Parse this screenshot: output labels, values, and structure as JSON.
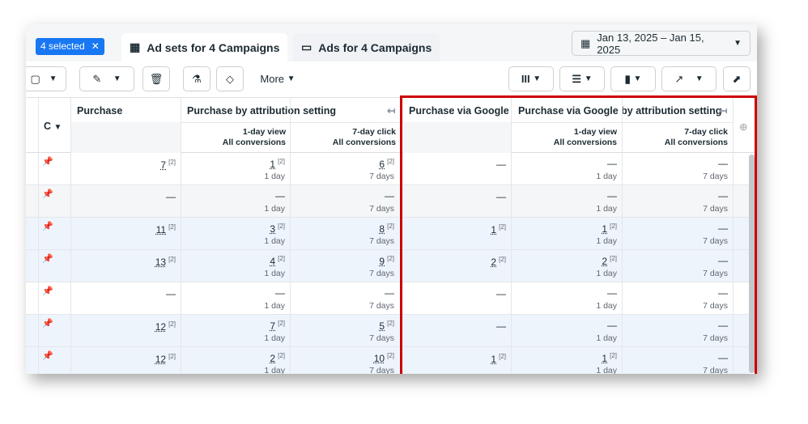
{
  "tabs": {
    "selected_badge": "4 selected",
    "ad_sets_tab": "Ad sets for 4 Campaigns",
    "ads_tab": "Ads for 4 Campaigns"
  },
  "date_range": "Jan 13, 2025 – Jan 15, 2025",
  "toolbar": {
    "more_label": "More"
  },
  "columns": {
    "c": "C",
    "purchase": "Purchase",
    "purchase_attr": "Purchase by attribution setting",
    "pvg": "Purchase via Google",
    "pvg_attr": "Purchase via Google by attribution setting",
    "view_line1": "1-day view",
    "view_line2": "All conversions",
    "click_line1": "7-day click",
    "click_line2": "All conversions"
  },
  "footnote": "[2]",
  "day1": "1 day",
  "day7": "7 days",
  "rows": [
    {
      "purchase": "7",
      "view": "1",
      "click": "6",
      "pvg": "—",
      "pvg_view": "—",
      "pvg_click": "—",
      "shade": "#ffffff"
    },
    {
      "purchase": "—",
      "view": "—",
      "click": "—",
      "pvg": "—",
      "pvg_view": "—",
      "pvg_click": "—",
      "shade": "#f5f6f7"
    },
    {
      "purchase": "11",
      "view": "3",
      "click": "8",
      "pvg": "1",
      "pvg_view": "1",
      "pvg_click": "—",
      "shade": "#eef4fc"
    },
    {
      "purchase": "13",
      "view": "4",
      "click": "9",
      "pvg": "2",
      "pvg_view": "2",
      "pvg_click": "—",
      "shade": "#eef4fc"
    },
    {
      "purchase": "—",
      "view": "—",
      "click": "—",
      "pvg": "—",
      "pvg_view": "—",
      "pvg_click": "—",
      "shade": "#ffffff"
    },
    {
      "purchase": "12",
      "view": "7",
      "click": "5",
      "pvg": "—",
      "pvg_view": "—",
      "pvg_click": "—",
      "shade": "#eef4fc"
    },
    {
      "purchase": "12",
      "view": "2",
      "click": "10",
      "pvg": "1",
      "pvg_view": "1",
      "pvg_click": "—",
      "shade": "#eef4fc"
    }
  ],
  "colors": {
    "accent": "#1877f2",
    "highlight_border": "#cc0000"
  }
}
